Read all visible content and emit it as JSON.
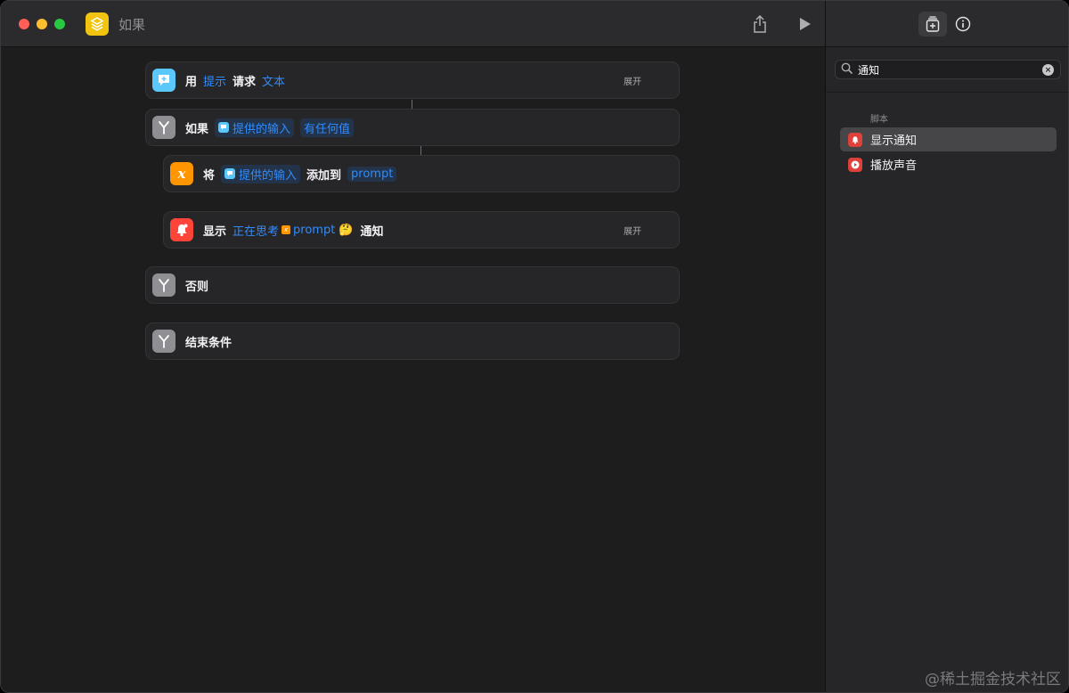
{
  "window": {
    "title": "如果"
  },
  "toolbar": {
    "share_icon": "share-icon",
    "run_icon": "play-icon"
  },
  "sidebar": {
    "tabs": [
      {
        "name": "add-action-icon",
        "active": true
      },
      {
        "name": "info-icon",
        "active": false
      }
    ],
    "search": {
      "value": "通知",
      "placeholder": ""
    },
    "section": "脚本",
    "items": [
      {
        "label": "显示通知",
        "icon": "bell-icon",
        "color": "#e0403a",
        "selected": true
      },
      {
        "label": "播放声音",
        "icon": "play-circle-icon",
        "color": "#e0403a",
        "selected": false
      }
    ]
  },
  "actions": {
    "ask": {
      "verb": "用",
      "prompt": "提示",
      "request": "请求",
      "type": "文本",
      "expand": "展开",
      "color": "#5ac8fa"
    },
    "if": {
      "verb": "如果",
      "input": "提供的输入",
      "condition": "有任何值",
      "color": "#8e8e93"
    },
    "append": {
      "verb": "将",
      "input": "提供的输入",
      "middle": "添加到",
      "variable": "prompt",
      "color": "#ff9500"
    },
    "notify": {
      "verb": "显示",
      "text": "正在思考",
      "variable": "prompt",
      "emoji": "🤔",
      "suffix": "通知",
      "expand": "展开",
      "color": "#ff453a"
    },
    "otherwise": {
      "label": "否则",
      "color": "#8e8e93"
    },
    "end": {
      "label": "结束条件",
      "color": "#8e8e93"
    }
  },
  "watermark": "@稀土掘金技术社区"
}
